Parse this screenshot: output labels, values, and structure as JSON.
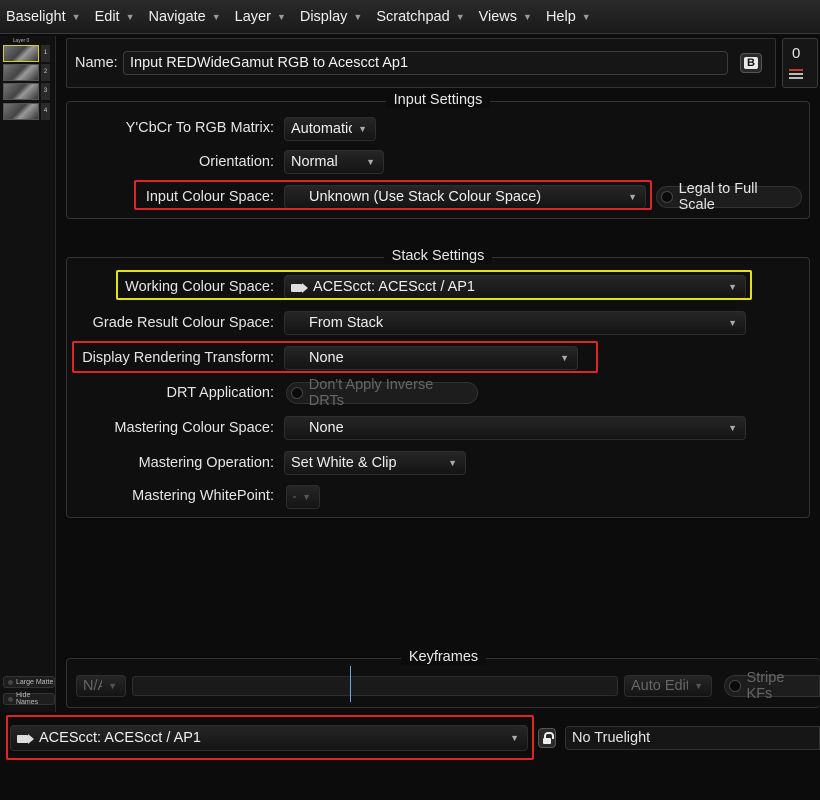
{
  "menu": [
    "Baselight",
    "Edit",
    "Navigate",
    "Layer",
    "Display",
    "Scratchpad",
    "Views",
    "Help"
  ],
  "sidebar": {
    "thumbs": [
      {
        "caption": "Layer 0",
        "num": "1"
      },
      {
        "caption": "",
        "num": "2"
      },
      {
        "caption": "",
        "num": "3"
      },
      {
        "caption": "",
        "num": "4"
      }
    ],
    "large_matte": "Large Matte",
    "hide_names": "Hide Names"
  },
  "name_panel": {
    "label": "Name:",
    "value": "Input REDWideGamut RGB to Acescct Ap1",
    "b_button": "B"
  },
  "counter": "0",
  "input_settings": {
    "title": "Input Settings",
    "ycbcr_label": "Y'CbCr To RGB Matrix:",
    "ycbcr_value": "Automatic",
    "orientation_label": "Orientation:",
    "orientation_value": "Normal",
    "input_colour_space_label": "Input Colour Space:",
    "input_colour_space_value": "Unknown (Use Stack Colour Space)",
    "legal_to_full": "Legal to Full Scale"
  },
  "stack_settings": {
    "title": "Stack Settings",
    "working_label": "Working Colour Space:",
    "working_value": "ACEScct: ACEScct / AP1",
    "grade_result_label": "Grade Result Colour Space:",
    "grade_result_value": "From Stack",
    "drt_label": "Display Rendering Transform:",
    "drt_value": "None",
    "drt_application_label": "DRT Application:",
    "drt_application_value": "Don't Apply Inverse DRTs",
    "mastering_cs_label": "Mastering Colour Space:",
    "mastering_cs_value": "None",
    "mastering_op_label": "Mastering Operation:",
    "mastering_op_value": "Set White & Clip",
    "mastering_wp_label": "Mastering WhitePoint:",
    "mastering_wp_value": "–"
  },
  "keyframes": {
    "title": "Keyframes",
    "na": "N/A",
    "auto_edit": "Auto Edit",
    "stripe": "Stripe KFs"
  },
  "bottom": {
    "colour_space": "ACEScct: ACEScct / AP1",
    "truelight": "No Truelight"
  },
  "colors": {
    "highlight_red": "#e12424",
    "highlight_yellow": "#e3e01a"
  }
}
